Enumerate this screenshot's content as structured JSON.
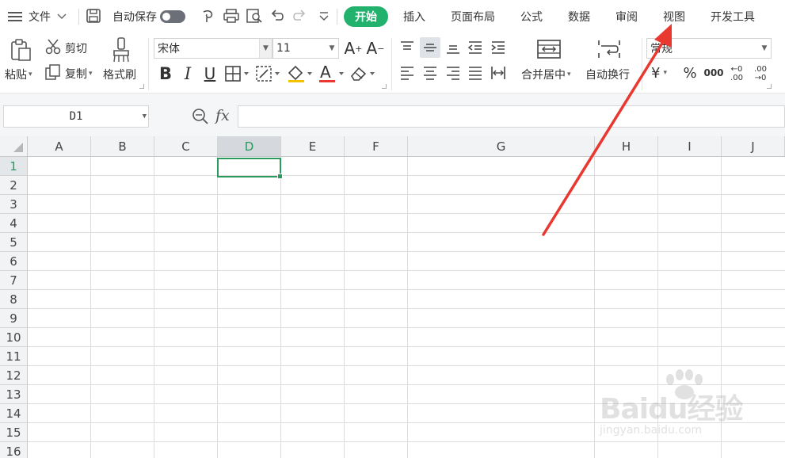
{
  "menubar": {
    "file_label": "文件",
    "autosave_label": "自动保存",
    "tabs": [
      {
        "label": "开始",
        "active": true
      },
      {
        "label": "插入"
      },
      {
        "label": "页面布局"
      },
      {
        "label": "公式"
      },
      {
        "label": "数据"
      },
      {
        "label": "审阅"
      },
      {
        "label": "视图"
      },
      {
        "label": "开发工具"
      }
    ]
  },
  "ribbon": {
    "paste_label": "粘贴",
    "cut_label": "剪切",
    "copy_label": "复制",
    "format_painter_label": "格式刷",
    "font_name": "宋体",
    "font_size": "11",
    "bold": "B",
    "italic": "I",
    "underline": "U",
    "merge_center_label": "合并居中",
    "wrap_text_label": "自动换行",
    "number_format": "常规",
    "currency_symbol": "¥",
    "percent_symbol": "%",
    "thousands_symbol": "000",
    "inc_decimal": "←0 .00",
    "dec_decimal": ".00 →0"
  },
  "formula_bar": {
    "name_box": "D1",
    "fx_label": "fx"
  },
  "grid": {
    "columns": [
      "A",
      "B",
      "C",
      "D",
      "E",
      "F",
      "G",
      "H",
      "I",
      "J"
    ],
    "rows": [
      "1",
      "2",
      "3",
      "4",
      "5",
      "6",
      "7",
      "8",
      "9",
      "10",
      "11",
      "12",
      "13",
      "14",
      "15",
      "16"
    ],
    "selected_column": "D",
    "selected_row": "1"
  },
  "watermark": {
    "brand": "Baidu经验",
    "url": "jingyan.baidu.com"
  },
  "colors": {
    "accent_green": "#23b26d",
    "selection_green": "#2a9a5f",
    "annotation_red": "#e8382f"
  }
}
